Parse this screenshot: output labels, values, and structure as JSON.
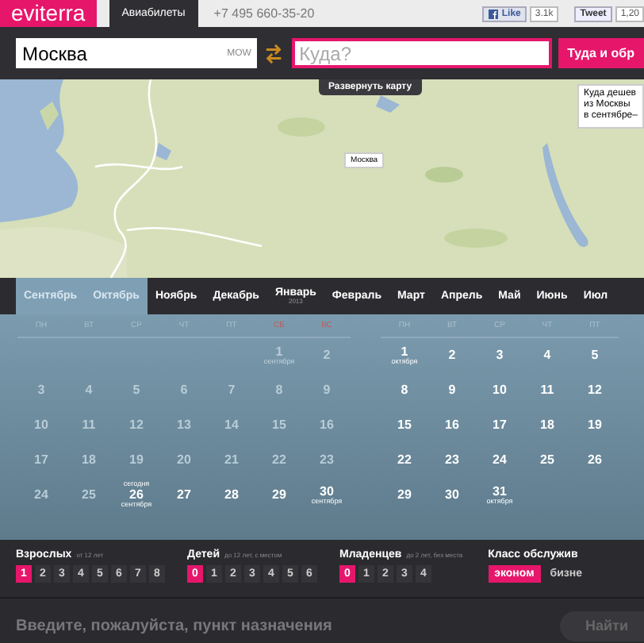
{
  "header": {
    "logo": "eviterra",
    "tabs": [
      {
        "label": "Авиабилеты",
        "selected": true
      }
    ],
    "phone": "+7 495 660-35-20",
    "like": {
      "label": "Like",
      "count": "3.1k"
    },
    "tweet": {
      "label": "Tweet",
      "count": "1,20"
    }
  },
  "search": {
    "from": {
      "value": "Москва",
      "code": "MOW"
    },
    "to": {
      "placeholder": "Куда?"
    },
    "button": "Туда и обр"
  },
  "map": {
    "expand": "Развернуть карту",
    "pin": "Москва",
    "popup": "Куда дешев\nиз Москвы\nв сентябре–"
  },
  "months": [
    {
      "label": "Сентябрь",
      "selected": true
    },
    {
      "label": "Октябрь",
      "selected": true
    },
    {
      "label": "Ноябрь",
      "selected": false
    },
    {
      "label": "Декабрь",
      "selected": false
    },
    {
      "label": "Январь",
      "year": "2013",
      "selected": false
    },
    {
      "label": "Февраль",
      "selected": false
    },
    {
      "label": "Март",
      "selected": false
    },
    {
      "label": "Апрель",
      "selected": false
    },
    {
      "label": "Май",
      "selected": false
    },
    {
      "label": "Июнь",
      "selected": false
    },
    {
      "label": "Июл",
      "selected": false
    }
  ],
  "calendar": [
    {
      "weekdays": [
        {
          "label": "ПН",
          "weekend": false
        },
        {
          "label": "ВТ",
          "weekend": false
        },
        {
          "label": "СР",
          "weekend": false
        },
        {
          "label": "ЧТ",
          "weekend": false
        },
        {
          "label": "ПТ",
          "weekend": false
        },
        {
          "label": "СБ",
          "weekend": true
        },
        {
          "label": "ВС",
          "weekend": true
        }
      ],
      "weeks": [
        [
          {
            "kind": "blank"
          },
          {
            "kind": "blank"
          },
          {
            "kind": "blank"
          },
          {
            "kind": "blank"
          },
          {
            "kind": "blank"
          },
          {
            "kind": "past",
            "day": "1",
            "below": "сентября"
          },
          {
            "kind": "past",
            "day": "2"
          }
        ],
        [
          {
            "kind": "past",
            "day": "3"
          },
          {
            "kind": "past",
            "day": "4"
          },
          {
            "kind": "past",
            "day": "5"
          },
          {
            "kind": "past",
            "day": "6"
          },
          {
            "kind": "past",
            "day": "7"
          },
          {
            "kind": "past",
            "day": "8"
          },
          {
            "kind": "past",
            "day": "9"
          }
        ],
        [
          {
            "kind": "past",
            "day": "10"
          },
          {
            "kind": "past",
            "day": "11"
          },
          {
            "kind": "past",
            "day": "12"
          },
          {
            "kind": "past",
            "day": "13"
          },
          {
            "kind": "past",
            "day": "14"
          },
          {
            "kind": "past",
            "day": "15"
          },
          {
            "kind": "past",
            "day": "16"
          }
        ],
        [
          {
            "kind": "past",
            "day": "17"
          },
          {
            "kind": "past",
            "day": "18"
          },
          {
            "kind": "past",
            "day": "19"
          },
          {
            "kind": "past",
            "day": "20"
          },
          {
            "kind": "past",
            "day": "21"
          },
          {
            "kind": "past",
            "day": "22"
          },
          {
            "kind": "past",
            "day": "23"
          }
        ],
        [
          {
            "kind": "past",
            "day": "24"
          },
          {
            "kind": "past",
            "day": "25"
          },
          {
            "kind": "open",
            "day": "26",
            "above": "сегодня",
            "below": "сентября"
          },
          {
            "kind": "open",
            "day": "27"
          },
          {
            "kind": "open",
            "day": "28"
          },
          {
            "kind": "open",
            "day": "29"
          },
          {
            "kind": "open",
            "day": "30",
            "below": "сентября"
          }
        ]
      ]
    },
    {
      "weekdays": [
        {
          "label": "ПН",
          "weekend": false
        },
        {
          "label": "ВТ",
          "weekend": false
        },
        {
          "label": "СР",
          "weekend": false
        },
        {
          "label": "ЧТ",
          "weekend": false
        },
        {
          "label": "ПТ",
          "weekend": false
        }
      ],
      "weeks": [
        [
          {
            "kind": "open",
            "day": "1",
            "below": "октября"
          },
          {
            "kind": "open",
            "day": "2"
          },
          {
            "kind": "open",
            "day": "3"
          },
          {
            "kind": "open",
            "day": "4"
          },
          {
            "kind": "open",
            "day": "5"
          }
        ],
        [
          {
            "kind": "open",
            "day": "8"
          },
          {
            "kind": "open",
            "day": "9"
          },
          {
            "kind": "open",
            "day": "10"
          },
          {
            "kind": "open",
            "day": "11"
          },
          {
            "kind": "open",
            "day": "12"
          }
        ],
        [
          {
            "kind": "open",
            "day": "15"
          },
          {
            "kind": "open",
            "day": "16"
          },
          {
            "kind": "open",
            "day": "17"
          },
          {
            "kind": "open",
            "day": "18"
          },
          {
            "kind": "open",
            "day": "19"
          }
        ],
        [
          {
            "kind": "open",
            "day": "22"
          },
          {
            "kind": "open",
            "day": "23"
          },
          {
            "kind": "open",
            "day": "24"
          },
          {
            "kind": "open",
            "day": "25"
          },
          {
            "kind": "open",
            "day": "26"
          }
        ],
        [
          {
            "kind": "open",
            "day": "29"
          },
          {
            "kind": "open",
            "day": "30"
          },
          {
            "kind": "open",
            "day": "31",
            "below": "октября"
          }
        ]
      ]
    }
  ],
  "passengers": [
    {
      "label": "Взрослых",
      "hint": "от 12 лет",
      "options": [
        {
          "label": "1",
          "selected": true
        },
        {
          "label": "2",
          "selected": false
        },
        {
          "label": "3",
          "selected": false
        },
        {
          "label": "4",
          "selected": false
        },
        {
          "label": "5",
          "selected": false
        },
        {
          "label": "6",
          "selected": false
        },
        {
          "label": "7",
          "selected": false
        },
        {
          "label": "8",
          "selected": false
        }
      ]
    },
    {
      "label": "Детей",
      "hint": "до 12 лет, с местом",
      "options": [
        {
          "label": "0",
          "selected": true
        },
        {
          "label": "1",
          "selected": false
        },
        {
          "label": "2",
          "selected": false
        },
        {
          "label": "3",
          "selected": false
        },
        {
          "label": "4",
          "selected": false
        },
        {
          "label": "5",
          "selected": false
        },
        {
          "label": "6",
          "selected": false
        }
      ]
    },
    {
      "label": "Младенцев",
      "hint": "до 2 лет, без места",
      "options": [
        {
          "label": "0",
          "selected": true
        },
        {
          "label": "1",
          "selected": false
        },
        {
          "label": "2",
          "selected": false
        },
        {
          "label": "3",
          "selected": false
        },
        {
          "label": "4",
          "selected": false
        }
      ]
    }
  ],
  "service_class": {
    "label": "Класс обслужив",
    "options": [
      {
        "label": "эконом",
        "selected": true
      },
      {
        "label": "бизне",
        "selected": false
      }
    ]
  },
  "footer": {
    "message": "Введите, пожалуйста, пункт назначения",
    "button": "Найти"
  }
}
